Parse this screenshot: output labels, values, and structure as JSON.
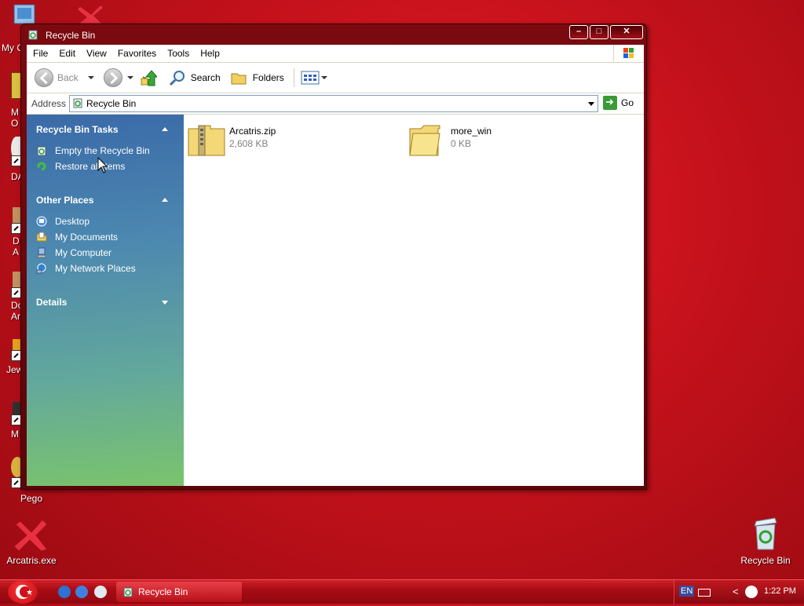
{
  "desktop": {
    "icons": [
      {
        "label": "My C",
        "name": "my-computer"
      },
      {
        "label": "M\nO",
        "name": "desktop-icon-2"
      },
      {
        "label": "DA",
        "name": "desktop-icon-3"
      },
      {
        "label": "D\nA",
        "name": "desktop-icon-4"
      },
      {
        "label": "Do\nAr",
        "name": "desktop-icon-5"
      },
      {
        "label": "Jew",
        "name": "desktop-icon-6"
      },
      {
        "label": "M",
        "name": "desktop-icon-7"
      },
      {
        "label": "Pego",
        "name": "pego"
      },
      {
        "label": "Arcatris.exe",
        "name": "arcatris-exe"
      }
    ],
    "recycle_bin_label": "Recycle Bin"
  },
  "window": {
    "title": "Recycle Bin",
    "controls": {
      "minimize": "–",
      "maximize": "□",
      "close": "✕"
    }
  },
  "menu": [
    "File",
    "Edit",
    "View",
    "Favorites",
    "Tools",
    "Help"
  ],
  "toolbar": {
    "back": "Back",
    "search": "Search",
    "folders": "Folders"
  },
  "address": {
    "label": "Address",
    "value": "Recycle Bin",
    "go": "Go"
  },
  "sidebar": {
    "tasks_title": "Recycle Bin Tasks",
    "tasks": [
      "Empty the Recycle Bin",
      "Restore all items"
    ],
    "places_title": "Other Places",
    "places": [
      "Desktop",
      "My Documents",
      "My Computer",
      "My Network Places"
    ],
    "details_title": "Details"
  },
  "files": [
    {
      "name": "Arcatris.zip",
      "size": "2,608 KB"
    },
    {
      "name": "more_win",
      "size": "0 KB"
    }
  ],
  "taskbar": {
    "task": "Recycle Bin",
    "lang": "EN",
    "time": "1:22 PM"
  }
}
